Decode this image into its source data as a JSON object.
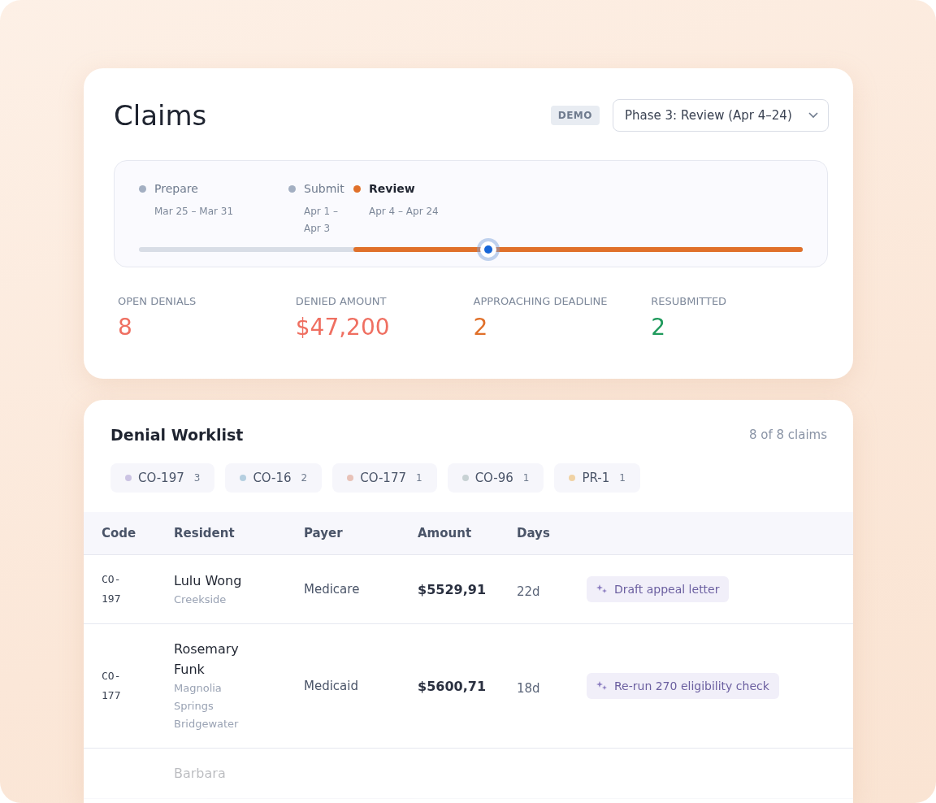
{
  "header": {
    "title": "Claims",
    "badge": "DEMO",
    "phase_select": {
      "value": "Phase 3: Review (Apr 4–24)"
    }
  },
  "timeline": {
    "phases": [
      {
        "label": "Prepare",
        "dates": "Mar 25 – Mar 31",
        "selected": false
      },
      {
        "label": "Submit",
        "dates": "Apr 1 – Apr 3",
        "selected": false
      },
      {
        "label": "Review",
        "dates": "Apr 4 – Apr 24",
        "selected": true
      }
    ],
    "level": 0.526
  },
  "stats": [
    {
      "label": "OPEN DENIALS",
      "value": "8",
      "color": "#ef6f61"
    },
    {
      "label": "DENIED AMOUNT",
      "value": "$47,200",
      "color": "#ef6f61"
    },
    {
      "label": "APPROACHING DEADLINE",
      "value": "2",
      "color": "#e0702a"
    },
    {
      "label": "RESUBMITTED",
      "value": "2",
      "color": "#1f9a5c"
    }
  ],
  "worklist": {
    "title": "Denial Worklist",
    "count": "8 of 8 claims",
    "filters": [
      {
        "code": "CO-197",
        "count": "3",
        "color": "#cbc3e3"
      },
      {
        "code": "CO-16",
        "count": "2",
        "color": "#b5cfe0"
      },
      {
        "code": "CO-177",
        "count": "1",
        "color": "#e8c2b8"
      },
      {
        "code": "CO-96",
        "count": "1",
        "color": "#c8d2d4"
      },
      {
        "code": "PR-1",
        "count": "1",
        "color": "#f0d2a4"
      }
    ],
    "columns": [
      "Code",
      "Resident",
      "Payer",
      "Amount",
      "Days"
    ],
    "rows": [
      {
        "code": "CO-197",
        "name": "Lulu Wong",
        "facility": "Creekside",
        "payer": "Medicare",
        "amount": "$5529,91",
        "days": "22d",
        "action": "Draft appeal letter",
        "faded": false
      },
      {
        "code": "CO-177",
        "name": "Rosemary Funk",
        "facility": "Magnolia Springs Bridgewater",
        "payer": "Medicaid",
        "amount": "$5600,71",
        "days": "18d",
        "action": "Re-run 270 eligibility check",
        "faded": false
      },
      {
        "name": "Barbara",
        "faded": true
      }
    ]
  }
}
